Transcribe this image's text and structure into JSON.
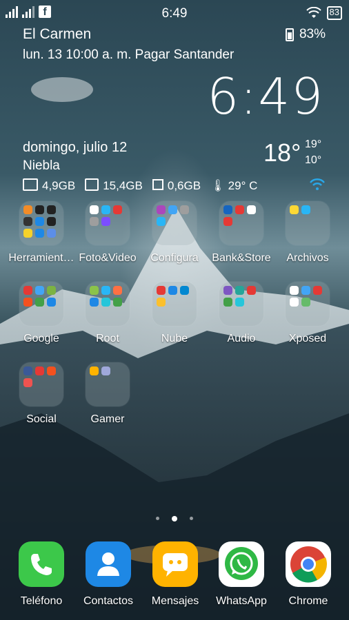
{
  "status_bar": {
    "time": "6:49",
    "battery_box": "83"
  },
  "widget": {
    "location": "El Carmen",
    "event": "lun. 13 10:00 a. m. Pagar Santander",
    "battery": "83%",
    "clock": "6:49",
    "date": "domingo, julio 12",
    "condition": "Niebla",
    "temperature": "18°",
    "temp_high": "19°",
    "temp_low": "10°",
    "stats": {
      "ram": "4,9GB",
      "storage": "15,4GB",
      "cpu": "0,6GB",
      "cpu_temp": "29° C"
    }
  },
  "folders": [
    {
      "label": "Herramientas",
      "display": "Herramient…",
      "minis": [
        "#f28c28",
        "#222",
        "#222",
        "#333",
        "#1e88e5",
        "#222",
        "#f5d22b",
        "#1e88e5",
        "#5c8ee8"
      ]
    },
    {
      "label": "Foto&Video",
      "minis": [
        "#ffffff",
        "#29b6f6",
        "#e53935",
        "#9e9e9e",
        "#7c4dff"
      ]
    },
    {
      "label": "Configura",
      "minis": [
        "#ab47bc",
        "#42a5f5",
        "#9e9e9e",
        "#29b6f6"
      ]
    },
    {
      "label": "Bank&Store",
      "minis": [
        "#1565c0",
        "#e53935",
        "#ffffff",
        "#e53935"
      ]
    },
    {
      "label": "Archivos",
      "minis": [
        "#fdd835",
        "#29b6f6"
      ]
    },
    {
      "label": "Google",
      "minis": [
        "#e53935",
        "#42a5f5",
        "#7cb342",
        "#f4511e",
        "#43a047",
        "#1e88e5"
      ]
    },
    {
      "label": "Root",
      "minis": [
        "#8bc34a",
        "#29b6f6",
        "#ff7043",
        "#1e88e5",
        "#26c6da",
        "#43a047"
      ]
    },
    {
      "label": "Nube",
      "minis": [
        "#e53935",
        "#1e88e5",
        "#0288d1",
        "#fbc02d"
      ]
    },
    {
      "label": "Audio",
      "minis": [
        "#7e57c2",
        "#26a69a",
        "#e53935",
        "#43a047",
        "#26c6da"
      ]
    },
    {
      "label": "Xposed",
      "minis": [
        "#ffffff",
        "#42a5f5",
        "#e53935",
        "#ffffff",
        "#66bb6a"
      ]
    },
    {
      "label": "Social",
      "minis": [
        "#3b5998",
        "#e53935",
        "#f4511e",
        "#ef5350"
      ]
    },
    {
      "label": "Gamer",
      "minis": [
        "#ffb300",
        "#9fa8da"
      ]
    }
  ],
  "page_indicator": {
    "count": 3,
    "active": 1
  },
  "dock": [
    {
      "label": "Teléfono",
      "color": "#3cc84a",
      "icon": "phone-icon"
    },
    {
      "label": "Contactos",
      "color": "#1e88e5",
      "icon": "contacts-icon"
    },
    {
      "label": "Mensajes",
      "color": "#ffb300",
      "icon": "message-icon"
    },
    {
      "label": "WhatsApp",
      "color": "#2fb845",
      "icon": "whatsapp-icon"
    },
    {
      "label": "Chrome",
      "color": "#ffffff",
      "icon": "chrome-icon"
    }
  ]
}
